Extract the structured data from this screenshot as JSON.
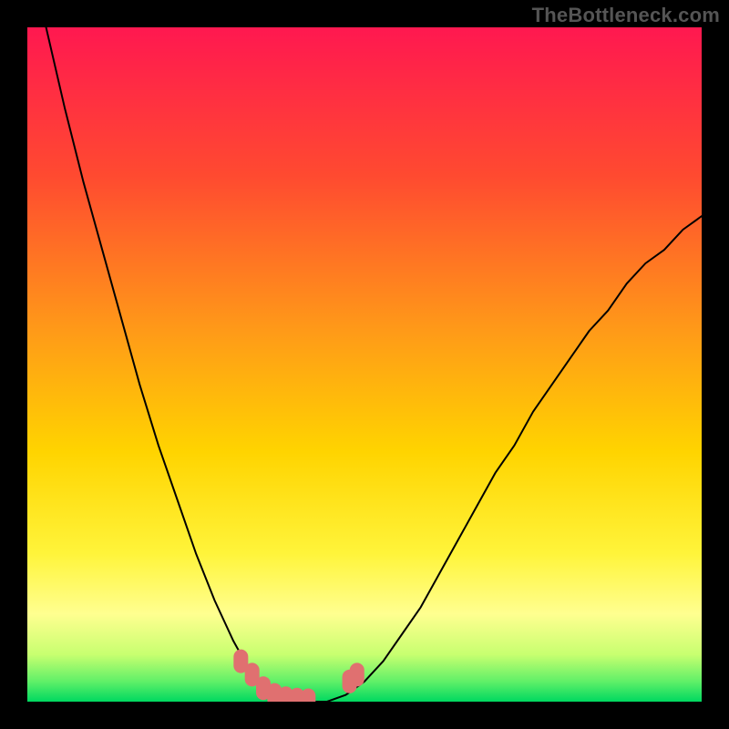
{
  "watermark": "TheBottleneck.com",
  "chart_data": {
    "type": "line",
    "title": "",
    "xlabel": "",
    "ylabel": "",
    "xlim": [
      0,
      180
    ],
    "ylim": [
      0,
      100
    ],
    "grid": false,
    "x": [
      0,
      5,
      10,
      15,
      20,
      25,
      30,
      35,
      40,
      45,
      50,
      55,
      60,
      65,
      70,
      75,
      80,
      85,
      90,
      95,
      100,
      105,
      110,
      115,
      120,
      125,
      130,
      135,
      140,
      145,
      150,
      155,
      160,
      165,
      170,
      175,
      180
    ],
    "values": [
      null,
      100,
      88,
      77,
      67,
      57,
      47,
      38,
      30,
      22,
      15,
      9,
      4,
      1,
      0,
      0,
      0,
      1,
      3,
      6,
      10,
      14,
      19,
      24,
      29,
      34,
      38,
      43,
      47,
      51,
      55,
      58,
      62,
      65,
      67,
      70,
      72
    ],
    "series": [
      {
        "name": "bottleneck-curve",
        "color": "#000000",
        "x": [
          0,
          5,
          10,
          15,
          20,
          25,
          30,
          35,
          40,
          45,
          50,
          55,
          60,
          65,
          70,
          75,
          80,
          85,
          90,
          95,
          100,
          105,
          110,
          115,
          120,
          125,
          130,
          135,
          140,
          145,
          150,
          155,
          160,
          165,
          170,
          175,
          180
        ],
        "y": [
          null,
          100,
          88,
          77,
          67,
          57,
          47,
          38,
          30,
          22,
          15,
          9,
          4,
          1,
          0,
          0,
          0,
          1,
          3,
          6,
          10,
          14,
          19,
          24,
          29,
          34,
          38,
          43,
          47,
          51,
          55,
          58,
          62,
          65,
          67,
          70,
          72
        ]
      }
    ],
    "highlight_points": [
      {
        "x": 57,
        "y": 6
      },
      {
        "x": 60,
        "y": 4
      },
      {
        "x": 63,
        "y": 2
      },
      {
        "x": 66,
        "y": 1
      },
      {
        "x": 69,
        "y": 0.5
      },
      {
        "x": 72,
        "y": 0.3
      },
      {
        "x": 75,
        "y": 0.2
      },
      {
        "x": 86,
        "y": 3
      },
      {
        "x": 88,
        "y": 4
      }
    ],
    "background_gradient": {
      "stops": [
        {
          "offset": 0.0,
          "color": "#ff1850"
        },
        {
          "offset": 0.22,
          "color": "#ff4a30"
        },
        {
          "offset": 0.45,
          "color": "#ff9a18"
        },
        {
          "offset": 0.63,
          "color": "#ffd400"
        },
        {
          "offset": 0.78,
          "color": "#fff43a"
        },
        {
          "offset": 0.87,
          "color": "#ffff90"
        },
        {
          "offset": 0.93,
          "color": "#c8ff70"
        },
        {
          "offset": 0.97,
          "color": "#60f068"
        },
        {
          "offset": 1.0,
          "color": "#00d860"
        }
      ]
    }
  }
}
